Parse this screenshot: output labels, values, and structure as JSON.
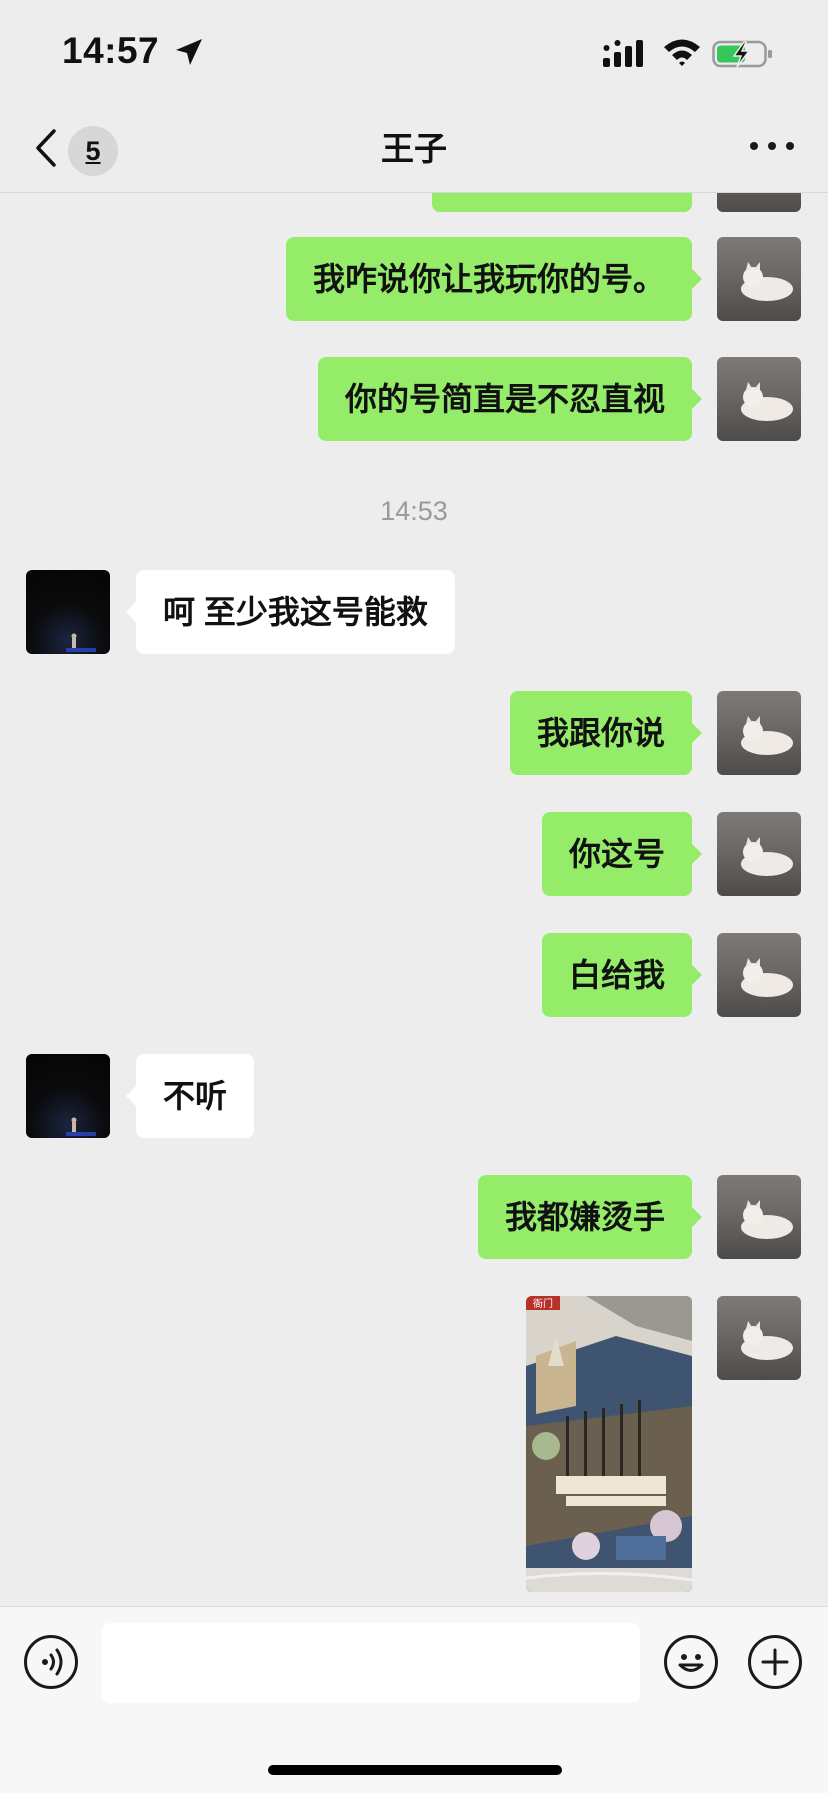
{
  "status_bar": {
    "time": "14:57"
  },
  "nav": {
    "unread_count": "5",
    "title": "王子"
  },
  "messages": [
    {
      "side": "out",
      "text": "我咋说你让我玩你的号。"
    },
    {
      "side": "out",
      "text": "你的号简直是不忍直视"
    },
    {
      "timestamp": "14:53"
    },
    {
      "side": "in",
      "text": "呵  至少我这号能救"
    },
    {
      "side": "out",
      "text": "我跟你说"
    },
    {
      "side": "out",
      "text": "你这号"
    },
    {
      "side": "out",
      "text": "白给我"
    },
    {
      "side": "in",
      "text": "不听"
    },
    {
      "side": "out",
      "text": "我都嫌烫手"
    },
    {
      "side": "out",
      "type": "image",
      "image_text": "衙门"
    }
  ],
  "input": {
    "placeholder": ""
  },
  "colors": {
    "out_bubble": "#95ec69",
    "in_bubble": "#ffffff",
    "background": "#ededed"
  },
  "icons": [
    "location-arrow-icon",
    "cellular-signal-icon",
    "wifi-icon",
    "battery-charging-icon",
    "back-chevron-icon",
    "more-dots-icon",
    "voice-icon",
    "emoji-icon",
    "plus-icon"
  ]
}
